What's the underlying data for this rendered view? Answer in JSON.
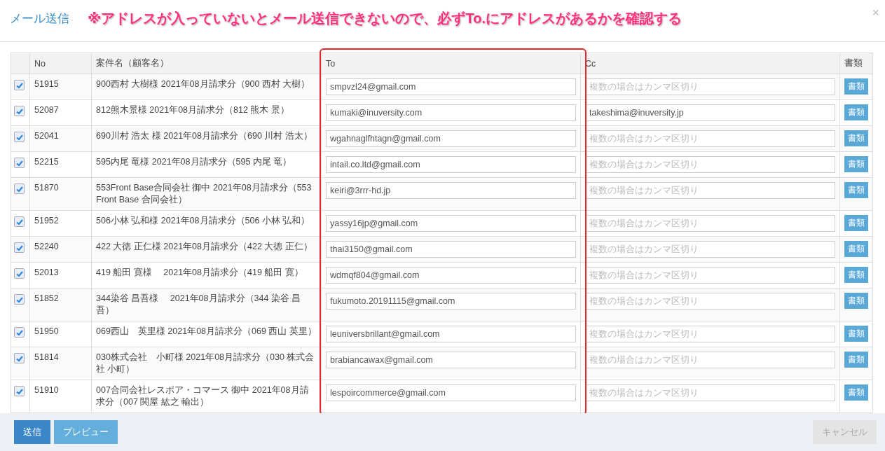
{
  "dialog": {
    "title": "メール送信",
    "close": "×",
    "annotation": "※アドレスが入っていないとメール送信できないので、必ずTo.にアドレスがあるかを確認する"
  },
  "table": {
    "columns": [
      "No",
      "案件名（顧客名）",
      "To",
      "Cc",
      "書類"
    ],
    "rows": [
      {
        "checked": true,
        "no": "51915",
        "name": "900西村 大樹様 2021年08月請求分（900 西村 大樹）",
        "to": "smpvzl24@gmail.com",
        "cc_placeholder": "複数の場合はカンマ区切り",
        "doc_button": "書類"
      },
      {
        "checked": true,
        "no": "52087",
        "name": "812熊木景様 2021年08月請求分（812 熊木 景）",
        "to": "kumaki@inuversity.com",
        "cc": "takeshima@inuversity.jp",
        "doc_button": "書類"
      },
      {
        "checked": true,
        "no": "52041",
        "name": "690川村 浩太 様 2021年08月請求分（690 川村 浩太）",
        "to": "wgahnaglfhtagn@gmail.com",
        "cc_placeholder": "複数の場合はカンマ区切り",
        "doc_button": "書類"
      },
      {
        "checked": true,
        "no": "52215",
        "name": "595内尾 竜様 2021年08月請求分（595 内尾 竜）",
        "to": "intail.co.ltd@gmail.com",
        "cc_placeholder": "複数の場合はカンマ区切り",
        "doc_button": "書類"
      },
      {
        "checked": true,
        "no": "51870",
        "name": "553Front Base合同会社 御中 2021年08月請求分（553 Front Base 合同会社）",
        "to": "keiri@3rrr-hd.jp",
        "cc_placeholder": "複数の場合はカンマ区切り",
        "doc_button": "書類"
      },
      {
        "checked": true,
        "no": "51952",
        "name": "506小林 弘和様 2021年08月請求分（506 小林 弘和）",
        "to": "yassy16jp@gmail.com",
        "cc_placeholder": "複数の場合はカンマ区切り",
        "doc_button": "書類"
      },
      {
        "checked": true,
        "no": "52240",
        "name": "422 大徳 正仁様 2021年08月請求分（422 大徳 正仁）",
        "to": "thai3150@gmail.com",
        "cc_placeholder": "複数の場合はカンマ区切り",
        "doc_button": "書類"
      },
      {
        "checked": true,
        "no": "52013",
        "name": "419 船田 寛様　 2021年08月請求分（419 船田 寛）",
        "to": "wdmqf804@gmail.com",
        "cc_placeholder": "複数の場合はカンマ区切り",
        "doc_button": "書類"
      },
      {
        "checked": true,
        "no": "51852",
        "name": "344染谷 昌吾様　 2021年08月請求分（344 染谷 昌吾）",
        "to": "fukumoto.20191115@gmail.com",
        "cc_placeholder": "複数の場合はカンマ区切り",
        "doc_button": "書類"
      },
      {
        "checked": true,
        "no": "51950",
        "name": "069西山　英里様 2021年08月請求分（069 西山 英里）",
        "to": "leuniversbrillant@gmail.com",
        "cc_placeholder": "複数の場合はカンマ区切り",
        "doc_button": "書類"
      },
      {
        "checked": true,
        "no": "51814",
        "name": "030株式会社　小町様 2021年08月請求分（030 株式会社 小町）",
        "to": "brabiancawax@gmail.com",
        "cc_placeholder": "複数の場合はカンマ区切り",
        "doc_button": "書類"
      },
      {
        "checked": true,
        "no": "51910",
        "name": "007合同会社レスポア・コマース 御中 2021年08月請求分（007 関屋 紘之 輸出）",
        "to": "lespoircommerce@gmail.com",
        "cc_placeholder": "複数の場合はカンマ区切り",
        "doc_button": "書類"
      }
    ]
  },
  "footer": {
    "buttons": [
      {
        "label": "送信",
        "kind": "primary",
        "disabled": false
      },
      {
        "label": "プレビュー",
        "kind": "secondary",
        "disabled": false
      },
      {
        "label": "キャンセル",
        "kind": "cancel",
        "disabled": true
      }
    ]
  }
}
